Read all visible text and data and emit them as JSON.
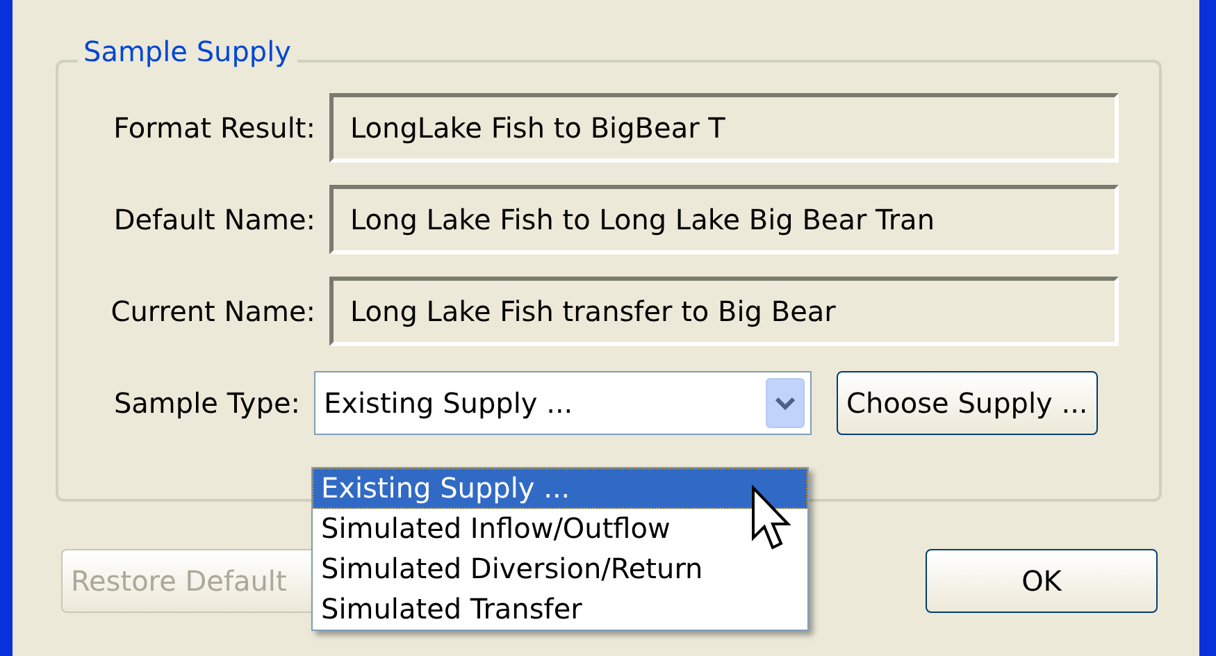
{
  "group": {
    "title": "Sample Supply"
  },
  "fields": [
    {
      "label": "Format Result:",
      "value": "LongLake Fish to BigBear T"
    },
    {
      "label": "Default Name:",
      "value": "Long Lake Fish to Long Lake Big Bear Tran"
    },
    {
      "label": "Current Name:",
      "value": "Long Lake Fish transfer to Big Bear"
    }
  ],
  "sample_type": {
    "label": "Sample Type:",
    "value": "Existing Supply ...",
    "expanded": true,
    "options": [
      {
        "label": "Existing Supply ...",
        "selected": true
      },
      {
        "label": "Simulated Inflow/Outflow",
        "selected": false
      },
      {
        "label": "Simulated Diversion/Return",
        "selected": false
      },
      {
        "label": "Simulated Transfer",
        "selected": false
      }
    ]
  },
  "choose_button": {
    "label": "Choose Supply ..."
  },
  "restore_button": {
    "label": "Restore Default",
    "disabled": true
  },
  "ok_button": {
    "label": "OK"
  }
}
